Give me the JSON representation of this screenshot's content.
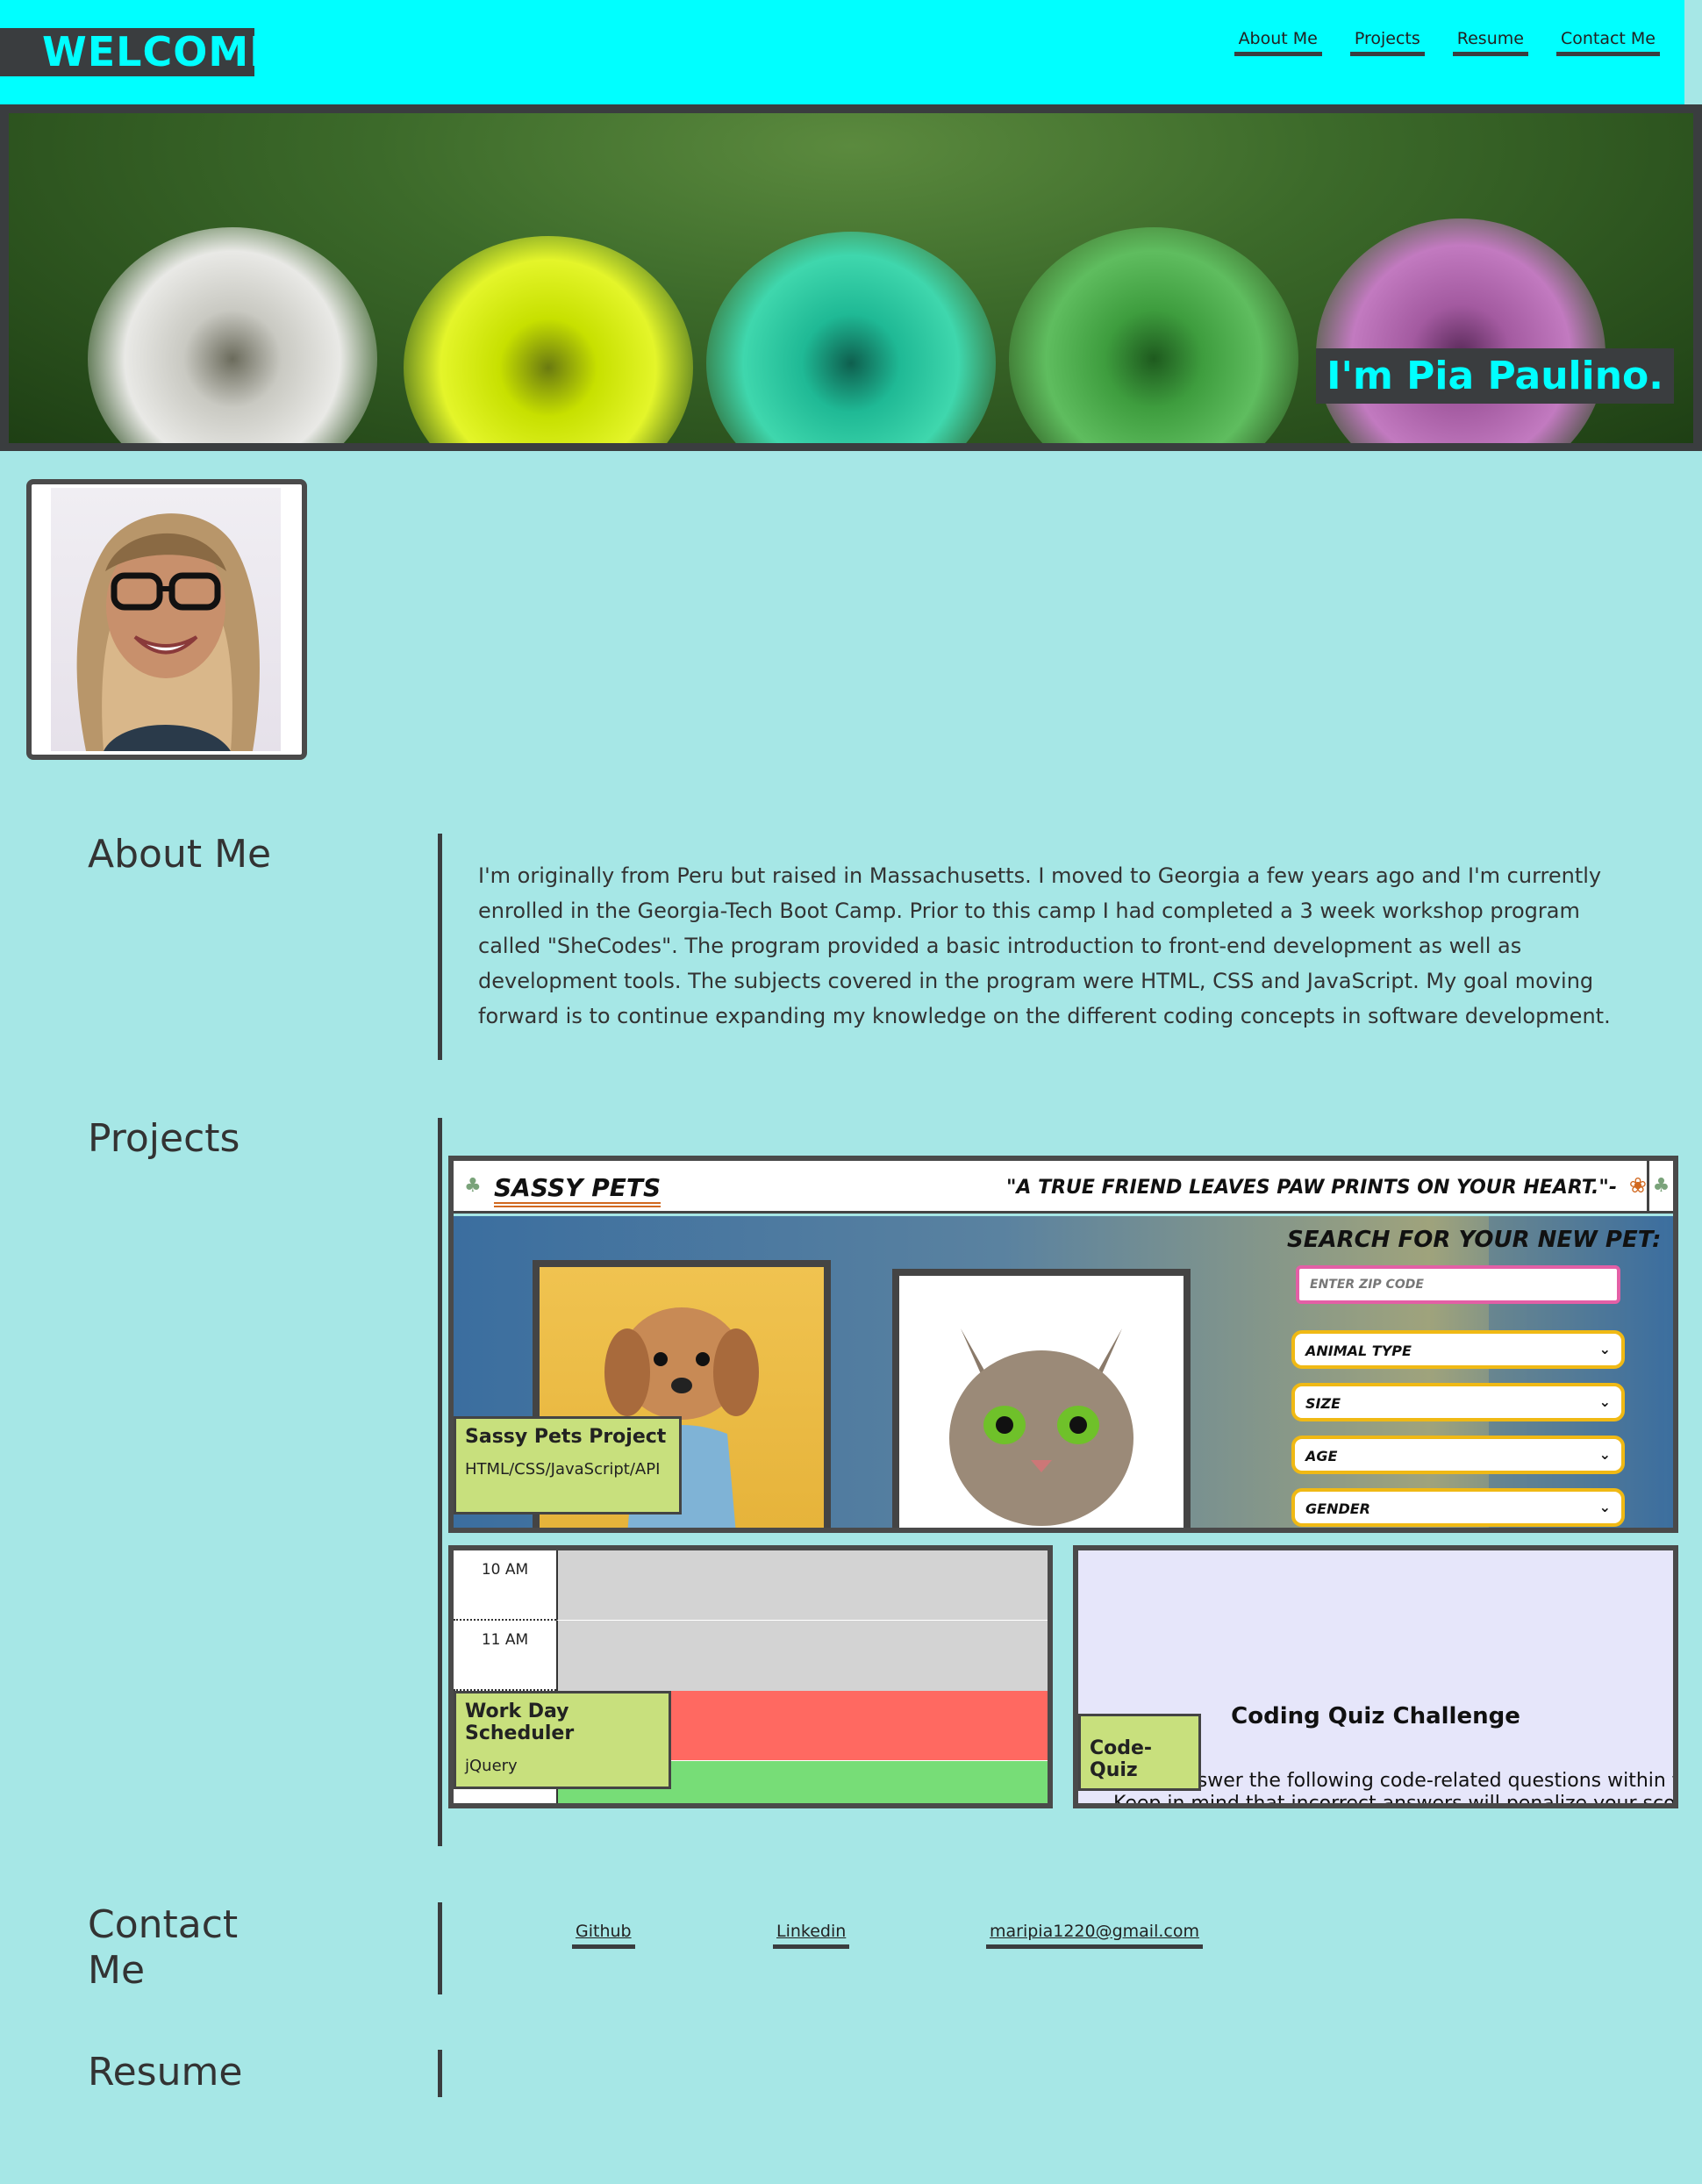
{
  "header": {
    "welcome": "WELCOME!",
    "nav": [
      "About Me",
      "Projects",
      "Resume",
      "Contact Me"
    ]
  },
  "hero": {
    "name": "I'm Pia Paulino."
  },
  "about": {
    "title": "About Me",
    "text": "I'm originally from Peru but raised in Massachusetts. I moved to Georgia a few years ago and I'm currently enrolled in the Georgia-Tech Boot Camp. Prior to this camp I had completed a 3 week workshop program called \"SheCodes\". The program provided a basic introduction to front-end development as well as development tools. The subjects covered in the program were HTML, CSS and JavaScript. My goal moving forward is to continue expanding my knowledge on the different coding concepts in software development."
  },
  "projects": {
    "title": "Projects",
    "sassy": {
      "logo": "SASSY PETS",
      "quote": "\"A TRUE FRIEND LEAVES PAW PRINTS ON YOUR HEART.\"-",
      "search_title": "SEARCH FOR YOUR NEW PET:",
      "zip_placeholder": "ENTER ZIP CODE",
      "selects": [
        "ANIMAL TYPE",
        "SIZE",
        "AGE",
        "GENDER"
      ],
      "label_title": "Sassy Pets Project",
      "label_sub": "HTML/CSS/JavaScript/API"
    },
    "scheduler": {
      "times": [
        "10 AM",
        "11 AM"
      ],
      "label_title": "Work Day Scheduler",
      "label_sub": "jQuery"
    },
    "quiz": {
      "title": "Coding Quiz Challenge",
      "line1": "Try to answer the following code-related questions within the time limit.",
      "line2": "Keep in mind that incorrect answers will penalize your score time by ten seconds!",
      "label_title": "Code-Quiz"
    }
  },
  "contact": {
    "title_line1": "Contact",
    "title_line2": "Me",
    "links": [
      "Github",
      "Linkedin",
      "maripia1220@gmail.com"
    ]
  },
  "resume": {
    "title": "Resume"
  },
  "colors": {
    "accent": "#00ffff",
    "background": "#a6e7e6",
    "dark": "#3a3d3f",
    "label": "#c8e07d"
  }
}
